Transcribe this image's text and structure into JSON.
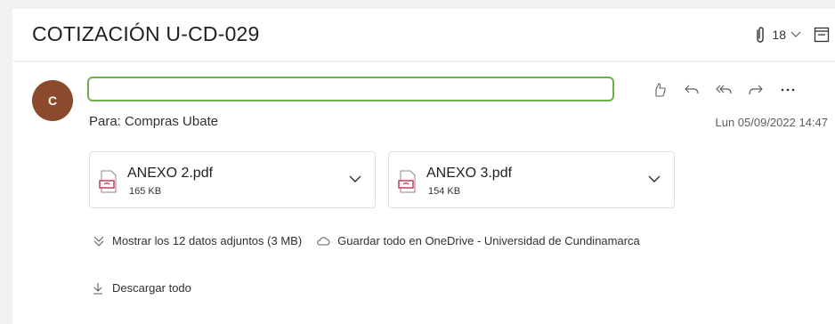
{
  "header": {
    "subject": "COTIZACIÓN U-CD-029",
    "attachment_count": "18",
    "icons": [
      "paperclip-icon",
      "chevron-down-icon",
      "reading-pane-icon"
    ]
  },
  "message": {
    "avatar_initial": "C",
    "avatar_color": "#8b4a2b",
    "sender_box_border": "#6bb04a",
    "to_label": "Para:",
    "to_value": "Compras Ubate",
    "date": "Lun 05/09/2022 14:47",
    "actions": [
      "like-icon",
      "reply-icon",
      "reply-all-icon",
      "forward-icon",
      "more-icon"
    ]
  },
  "attachments": [
    {
      "name": "ANEXO 2.pdf",
      "size": "165 KB"
    },
    {
      "name": "ANEXO 3.pdf",
      "size": "154 KB"
    }
  ],
  "footer": {
    "show_all": "Mostrar los 12 datos adjuntos (3 MB)",
    "save_all": "Guardar todo en OneDrive - Universidad de Cundinamarca",
    "download_all": "Descargar todo"
  }
}
